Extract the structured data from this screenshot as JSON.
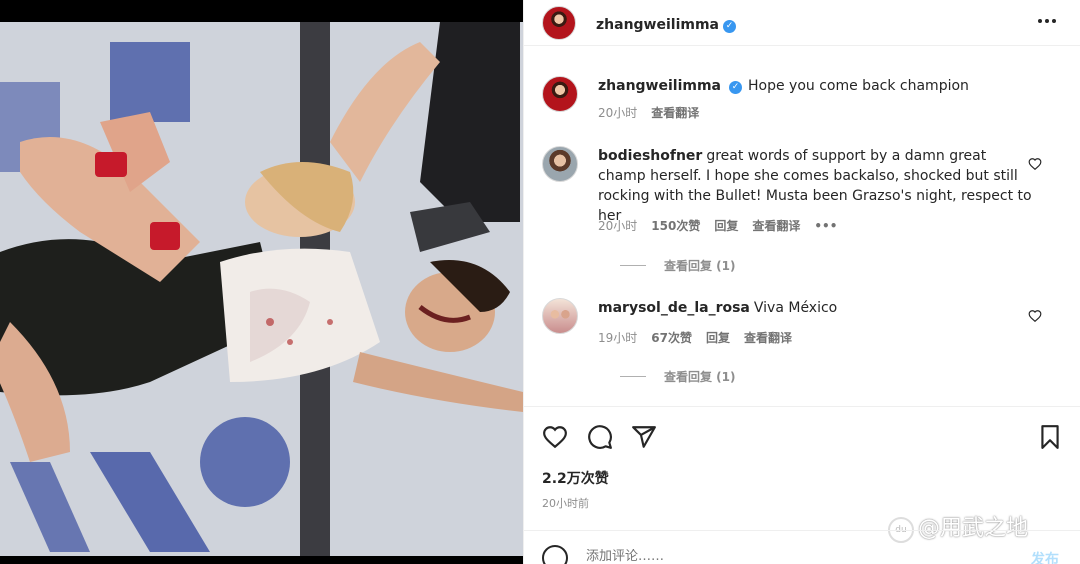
{
  "post": {
    "author": "zhangweilimma",
    "caption": "Hope you come back champion",
    "caption_time": "20小时",
    "caption_translate": "查看翻译",
    "more_label": "•••"
  },
  "comments": [
    {
      "username": "bodieshofner",
      "text": "great words of support by a damn great champ herself. I hope she comes backalso, shocked but still rocking with the Bullet! Musta been Grazso's night, respect to her",
      "time": "20小时",
      "likes": "150次赞",
      "reply": "回复",
      "translate": "查看翻译",
      "more": "•••",
      "view_replies": "查看回复 (1)"
    },
    {
      "username": "marysol_de_la_rosa",
      "text": "Viva México",
      "time": "19小时",
      "likes": "67次赞",
      "reply": "回复",
      "translate": "查看翻译",
      "view_replies": "查看回复 (1)"
    }
  ],
  "stats": {
    "likes": "2.2万次赞",
    "time_ago": "20小时前"
  },
  "add_comment": {
    "placeholder": "添加评论……",
    "post_label": "发布"
  },
  "watermark": {
    "text": "@用武之地",
    "paw": "du"
  },
  "icons": {
    "verified": "verified-badge-icon",
    "like": "heart-icon",
    "comment": "comment-bubble-icon",
    "share": "paper-plane-icon",
    "save": "bookmark-icon",
    "emoji": "smiley-icon",
    "more": "more-horizontal-icon"
  },
  "colors": {
    "verified_blue": "#3897f0",
    "text_primary": "#262626",
    "text_secondary": "#8e8e8e",
    "post_button_disabled": "#b2dffc"
  }
}
